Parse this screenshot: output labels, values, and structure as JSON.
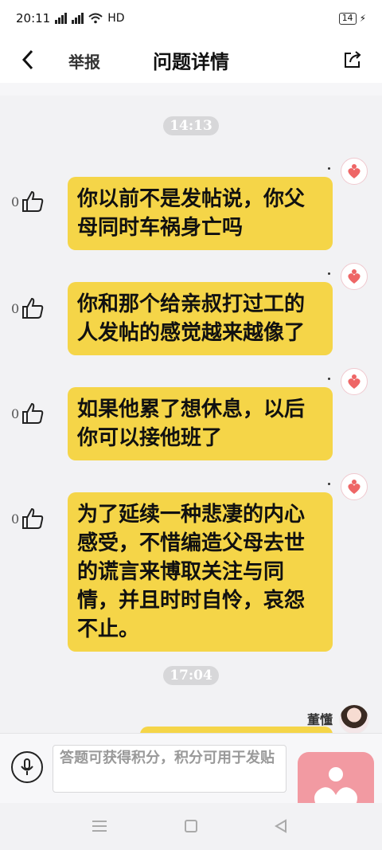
{
  "status_bar": {
    "time": "20:11",
    "signal1": "4G",
    "signal2": "4G",
    "network": "HD",
    "battery": "14"
  },
  "header": {
    "report_label": "举报",
    "title": "问题详情"
  },
  "chat": {
    "time_1": "14:13",
    "messages": [
      {
        "likes": "0",
        "text": "你以前不是发帖说，你父母同时车祸身亡吗"
      },
      {
        "likes": "0",
        "text": "你和那个给亲叔打过工的人发帖的感觉越来越像了"
      },
      {
        "likes": "0",
        "text": "如果他累了想休息，以后你可以接他班了"
      },
      {
        "likes": "0",
        "text": "为了延续一种悲凄的内心感受，不惜编造父母去世的谎言来博取关注与同情，并且时时自怜，哀怨不止。"
      }
    ],
    "time_2": "17:04",
    "user_name": "董懂"
  },
  "input": {
    "placeholder": "答题可获得积分，积分可用于发贴"
  },
  "colors": {
    "bubble": "#f5d548",
    "heart": "#f29aa2"
  }
}
